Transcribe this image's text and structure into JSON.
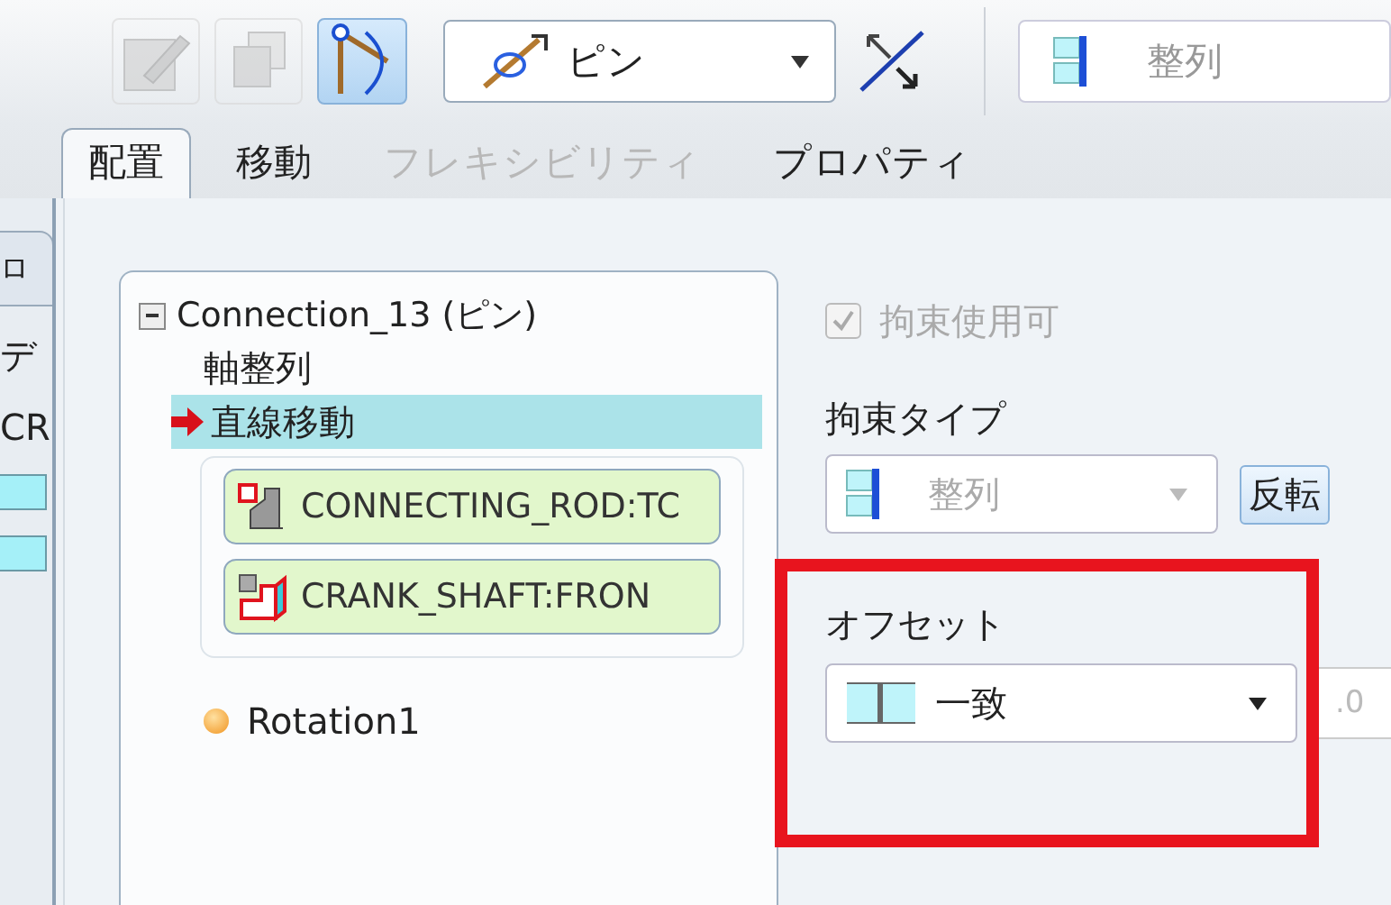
{
  "toolbar": {
    "tools": [
      {
        "kind": "edit",
        "disabled": true,
        "selected": false
      },
      {
        "kind": "copy",
        "disabled": true,
        "selected": false
      },
      {
        "kind": "pin-joint",
        "disabled": false,
        "selected": true
      }
    ],
    "connection_type": {
      "value": "ピン"
    },
    "constraint_type": {
      "value": "整列",
      "disabled": true
    }
  },
  "tabs": [
    {
      "label": "配置",
      "selected": true,
      "disabled": false
    },
    {
      "label": "移動",
      "selected": false,
      "disabled": false
    },
    {
      "label": "フレキシビリティ",
      "selected": false,
      "disabled": true
    },
    {
      "label": "プロパティ",
      "selected": false,
      "disabled": false
    }
  ],
  "side_strip": {
    "tab": "ロ",
    "texts": [
      "デ",
      "CR"
    ]
  },
  "tree": {
    "label": "Connection_13 (ピン)",
    "expanded": true,
    "children": [
      {
        "kind": "constraint",
        "label": "軸整列",
        "selected": false
      },
      {
        "kind": "constraint",
        "label": "直線移動",
        "selected": true,
        "references": [
          {
            "kind": "assembly",
            "label": "CONNECTING_ROD:TC"
          },
          {
            "kind": "part",
            "label": "CRANK_SHAFT:FRON"
          }
        ]
      },
      {
        "kind": "motion",
        "label": "Rotation1",
        "selected": false
      }
    ]
  },
  "properties": {
    "enabled": {
      "label": "拘束使用可",
      "checked": true,
      "disabled": true
    },
    "constraint_type": {
      "label": "拘束タイプ",
      "value": "整列",
      "disabled": true,
      "flip_button": "反転"
    },
    "offset": {
      "label": "オフセット",
      "value": "一致",
      "field": ".0"
    }
  }
}
